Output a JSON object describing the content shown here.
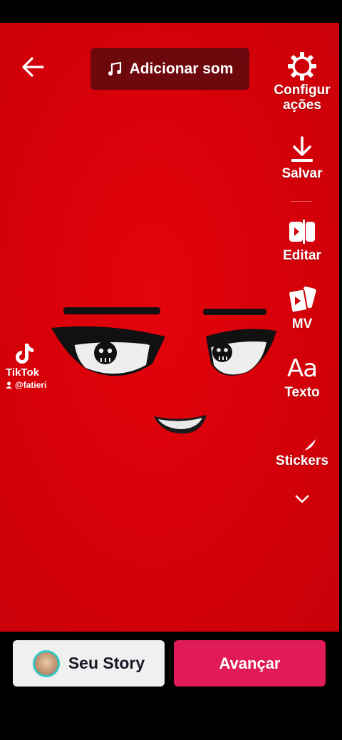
{
  "top_bar": {
    "add_sound_label": "Adicionar som"
  },
  "tools": [
    {
      "label": "Configurações",
      "icon": "gear-icon"
    },
    {
      "label": "Salvar",
      "icon": "download-icon"
    },
    {
      "label": "Editar",
      "icon": "edit-clip-icon"
    },
    {
      "label": "MV",
      "icon": "mv-cards-icon"
    },
    {
      "label": "Texto",
      "icon": "text-aa-icon"
    },
    {
      "label": "Stickers",
      "icon": "sticker-face-icon"
    }
  ],
  "watermark": {
    "brand": "TikTok",
    "username": "@fatieri"
  },
  "bottom": {
    "story_label": "Seu Story",
    "next_label": "Avançar"
  },
  "colors": {
    "canvas_red": "#d80009",
    "next_button": "#e01b58",
    "story_button": "#f0f0f0",
    "avatar_ring": "#31c7c3"
  }
}
